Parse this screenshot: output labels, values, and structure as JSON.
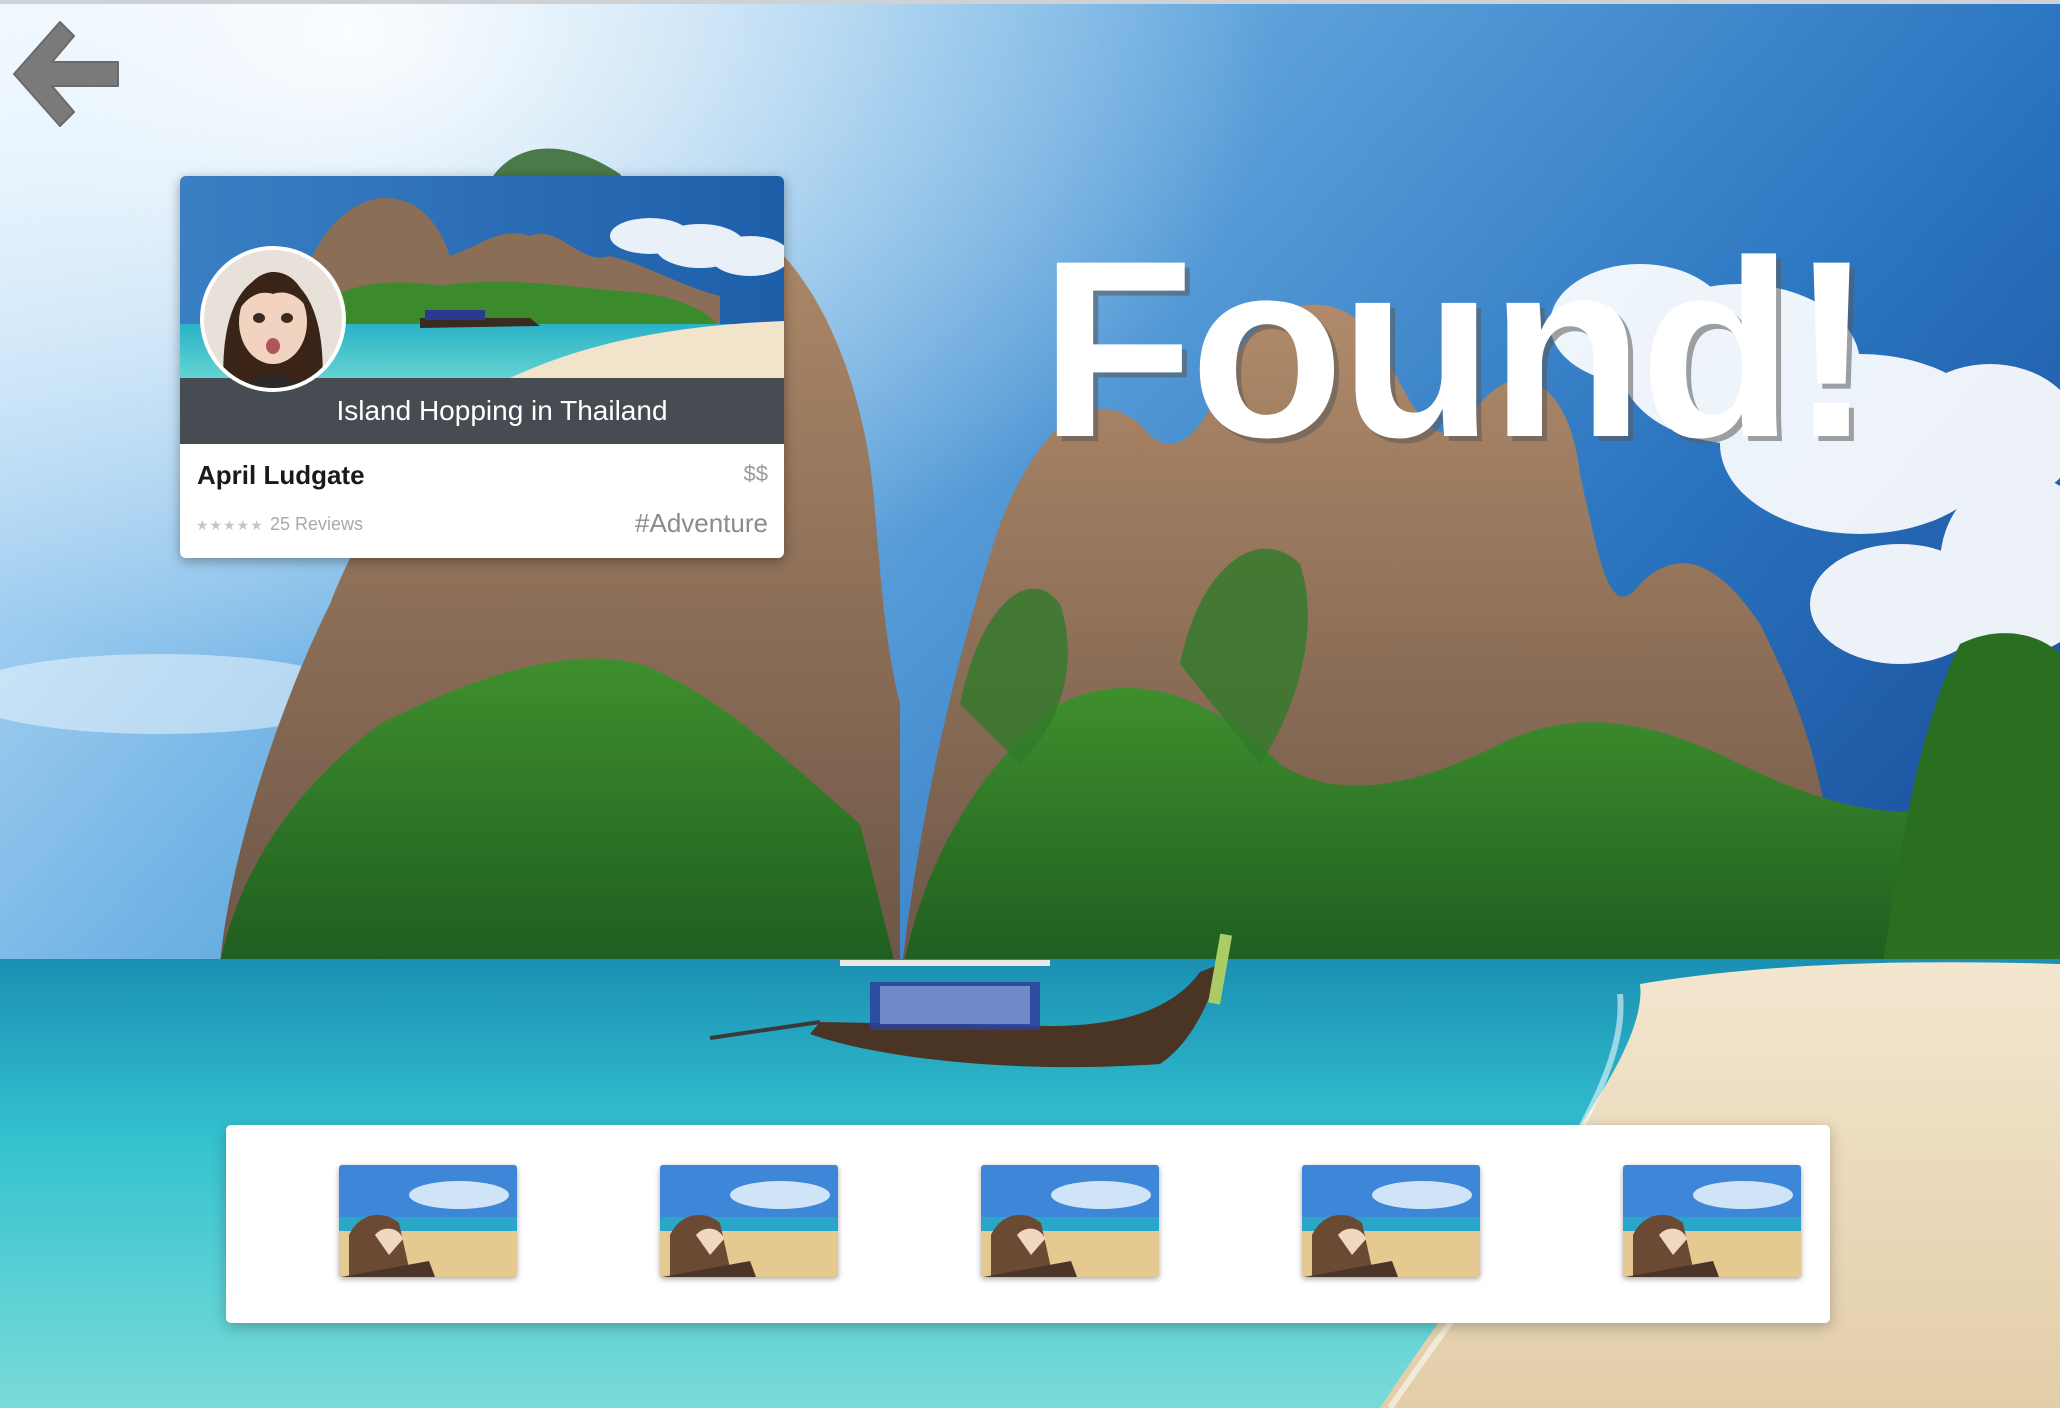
{
  "hero": {
    "title": "Found!"
  },
  "navigation": {
    "back_icon": "arrow-left-icon"
  },
  "card": {
    "title": "Island Hopping in Thailand",
    "author": "April Ludgate",
    "price": "$$",
    "stars": "★★★★★",
    "reviews": "25 Reviews",
    "tag": "#Adventure",
    "avatar_icon": "user-avatar"
  },
  "thumbnails": [
    {
      "icon": "beach-photo-thumbnail"
    },
    {
      "icon": "beach-photo-thumbnail"
    },
    {
      "icon": "beach-photo-thumbnail"
    },
    {
      "icon": "beach-photo-thumbnail"
    },
    {
      "icon": "beach-photo-thumbnail"
    }
  ],
  "colors": {
    "card_title_bar": "#474b52",
    "back_arrow": "#7a7a7a",
    "title_text": "#ffffff"
  }
}
